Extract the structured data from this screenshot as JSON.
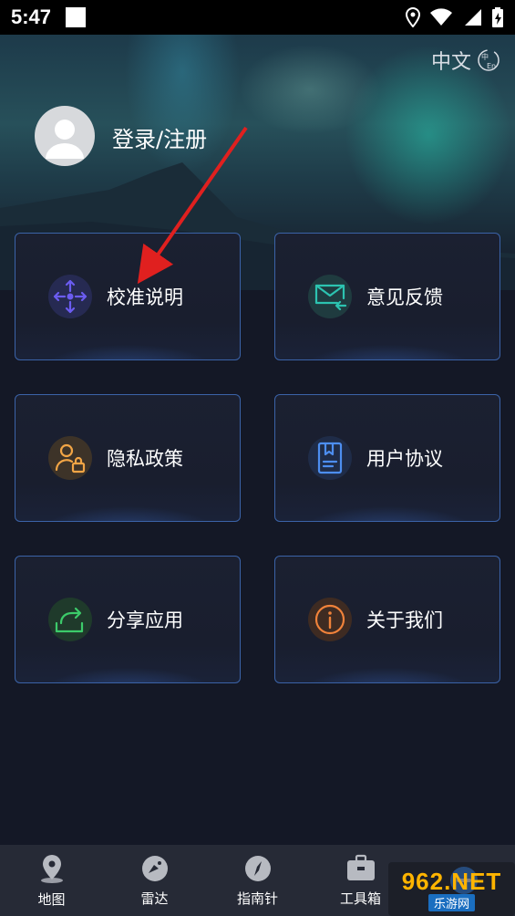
{
  "status_bar": {
    "time": "5:47",
    "icons": [
      "location-icon",
      "wifi-icon",
      "signal-icon",
      "battery-icon"
    ]
  },
  "header": {
    "language_label": "中文",
    "language_icon": "language-switch-icon",
    "login_label": "登录/注册"
  },
  "menu": {
    "calibration": {
      "label": "校准说明",
      "icon": "calibration-icon",
      "color": "#6b5cf0"
    },
    "feedback": {
      "label": "意见反馈",
      "icon": "mail-icon",
      "color": "#2cc3b0"
    },
    "privacy": {
      "label": "隐私政策",
      "icon": "user-lock-icon",
      "color": "#f2a545"
    },
    "agreement": {
      "label": "用户协议",
      "icon": "document-icon",
      "color": "#4d8ef0"
    },
    "share": {
      "label": "分享应用",
      "icon": "share-icon",
      "color": "#3ccb6a"
    },
    "about": {
      "label": "关于我们",
      "icon": "info-icon",
      "color": "#f0823a"
    }
  },
  "bottom_nav": {
    "map": "地图",
    "radar": "雷达",
    "compass": "指南针",
    "toolbox": "工具箱"
  },
  "watermark": {
    "brand": "962.NET",
    "site": "乐游网"
  }
}
